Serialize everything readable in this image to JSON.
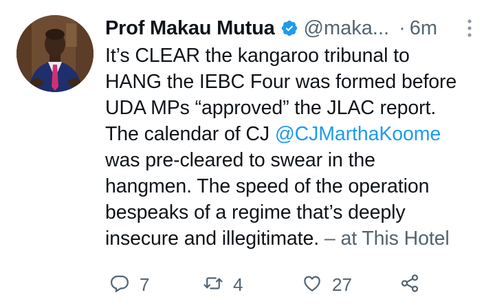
{
  "author": {
    "name": "Prof Makau Mutua",
    "handle": "@maka...",
    "separator": "·",
    "time": "6m"
  },
  "body": {
    "line1": "It’s CLEAR the kangaroo tribunal to",
    "line2": "HANG the IEBC Four was formed before",
    "line3": "UDA MPs “approved” the JLAC report.",
    "line4_pre": "The calendar of CJ ",
    "mention": "@CJMarthaKoome",
    "line5": "was pre-cleared to swear in the",
    "line6": "hangmen.  The speed of the operation",
    "line7": "bespeaks of a regime that’s deeply",
    "line8": "insecure and illegitimate.",
    "location": " – at This Hotel"
  },
  "actions": {
    "replies": "7",
    "retweets": "4",
    "likes": "27"
  },
  "colors": {
    "accent": "#1d9bf0",
    "muted": "#536471",
    "text": "#0f1419"
  },
  "icons": [
    "avatar",
    "verified-badge-icon",
    "more-icon",
    "reply-icon",
    "retweet-icon",
    "like-icon",
    "share-icon"
  ]
}
